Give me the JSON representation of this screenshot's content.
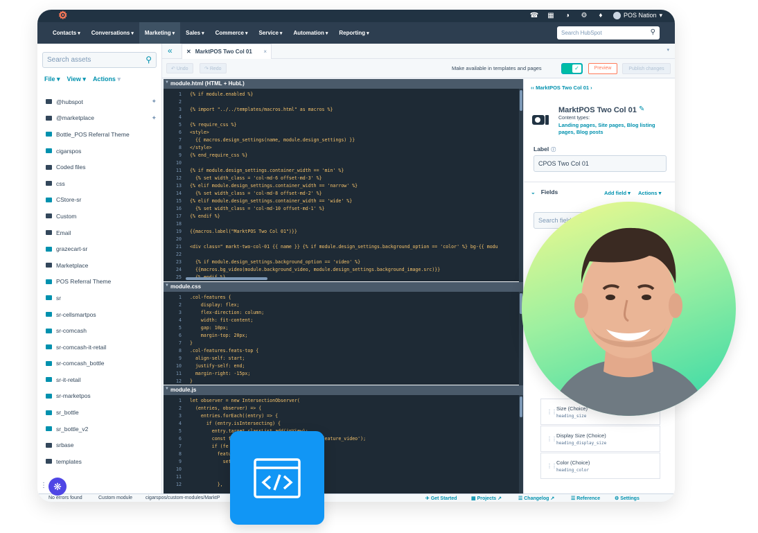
{
  "app": {
    "logo": "hubspot-logo"
  },
  "util_bar": {
    "account_name": "POS Nation"
  },
  "nav": {
    "items": [
      "Contacts",
      "Conversations",
      "Marketing",
      "Sales",
      "Commerce",
      "Service",
      "Automation",
      "Reporting"
    ],
    "active": "Marketing",
    "search_placeholder": "Search HubSpot"
  },
  "sidebar": {
    "search_placeholder": "Search assets",
    "menu": {
      "file": "File",
      "view": "View",
      "actions": "Actions"
    },
    "items": [
      {
        "label": "@hubspot",
        "type": "folder",
        "pinned": true
      },
      {
        "label": "@marketplace",
        "type": "folder",
        "pinned": true
      },
      {
        "label": "Bottle_POS Referral Theme",
        "type": "theme"
      },
      {
        "label": "cigarspos",
        "type": "theme"
      },
      {
        "label": "Coded files",
        "type": "folder"
      },
      {
        "label": "css",
        "type": "folder"
      },
      {
        "label": "CStore-sr",
        "type": "theme"
      },
      {
        "label": "Custom",
        "type": "folder"
      },
      {
        "label": "Email",
        "type": "folder"
      },
      {
        "label": "grazecart-sr",
        "type": "theme"
      },
      {
        "label": "Marketplace",
        "type": "folder"
      },
      {
        "label": "POS Referral Theme",
        "type": "theme"
      },
      {
        "label": "sr",
        "type": "theme"
      },
      {
        "label": "sr-cellsmartpos",
        "type": "theme"
      },
      {
        "label": "sr-comcash",
        "type": "theme"
      },
      {
        "label": "sr-comcash-it-retail",
        "type": "theme"
      },
      {
        "label": "sr-comcash_bottle",
        "type": "theme"
      },
      {
        "label": "sr-it-retail",
        "type": "theme"
      },
      {
        "label": "sr-marketpos",
        "type": "theme"
      },
      {
        "label": "sr_bottle",
        "type": "theme"
      },
      {
        "label": "sr_bottle_v2",
        "type": "theme"
      },
      {
        "label": "srbase",
        "type": "folder"
      },
      {
        "label": "templates",
        "type": "folder"
      }
    ]
  },
  "tab": {
    "label": "MarktPOS Two Col 01"
  },
  "toolbar": {
    "undo": "Undo",
    "redo": "Redo",
    "available_label": "Make available in templates and pages",
    "preview": "Preview",
    "publish": "Publish changes"
  },
  "panes": [
    {
      "title": "module.html (HTML + HubL)",
      "lines": [
        "{% if module.enabled %}",
        "",
        "{% import \"../../templates/macros.html\" as macros %}",
        "",
        "{% require_css %}",
        "<style>",
        "  {{ macros.design_settings(name, module.design_settings) }}",
        "</style>",
        "{% end_require_css %}",
        "",
        "{% if module.design_settings.container_width == 'min' %}",
        "  {% set width_class = 'col-md-6 offset-md-3' %}",
        "{% elif module.design_settings.container_width == 'narrow' %}",
        "  {% set width_class = 'col-md-8 offset-md-2' %}",
        "{% elif module.design_settings.container_width == 'wide' %}",
        "  {% set width_class = 'col-md-10 offset-md-1' %}",
        "{% endif %}",
        "",
        "{{macros.label(\"MarktPOS Two Col 01\")}}",
        "",
        "<div class=\" markt-two-col-01 {{ name }} {% if module.design_settings.background_option == 'color' %} bg-{{ modu",
        "",
        "  {% if module.design_settings.background_option == 'video' %}",
        "  {{macros.bg_video(module.background_video, module.design_settings.background_image.src)}}",
        "  {% endif %}"
      ]
    },
    {
      "title": "module.css",
      "lines": [
        ".col-features {",
        "    display: flex;",
        "    flex-direction: column;",
        "    width: fit-content;",
        "    gap: 10px;",
        "    margin-top: 20px;",
        "}",
        ".col-features.feats-top {",
        "  align-self: start;",
        "  justify-self: end;",
        "  margin-right: -15px;",
        "}"
      ]
    },
    {
      "title": "module.js",
      "lines": [
        "let observer = new IntersectionObserver(",
        "  (entries, observer) => {",
        "    entries.forEach((entry) => {",
        "      if (entry.isIntersecting) {",
        "        entry.target.classList.add(inView);",
        "        const f                 rySelectorAll('.feature_video');",
        "        if (fe",
        "          featu",
        "            set",
        "              ",
        "              ",
        "          },"
      ]
    }
  ],
  "right_panel": {
    "breadcrumb": "MarktPOS Two Col 01",
    "module_title": "MarktPOS Two Col 01",
    "content_types_label": "Content types:",
    "content_types": "Landing pages, Site pages, Blog listing pages, Blog posts",
    "label_heading": "Label",
    "label_value": "CPOS Two Col 01",
    "fields_heading": "Fields",
    "add_field": "Add field",
    "actions": "Actions",
    "search_fields_placeholder": "Search field",
    "fields": [
      {
        "name": "Size (Choice)",
        "id": "heading_size"
      },
      {
        "name": "Display Size (Choice)",
        "id": "heading_display_size"
      },
      {
        "name": "Color (Choice)",
        "id": "heading_color"
      }
    ]
  },
  "status_bar": {
    "errors": "No errors found",
    "module_type": "Custom module",
    "path": "cigarspos/custom-modules/MarktP",
    "links": [
      "Get Started",
      "Projects",
      "Changelog",
      "Reference",
      "Settings"
    ]
  }
}
